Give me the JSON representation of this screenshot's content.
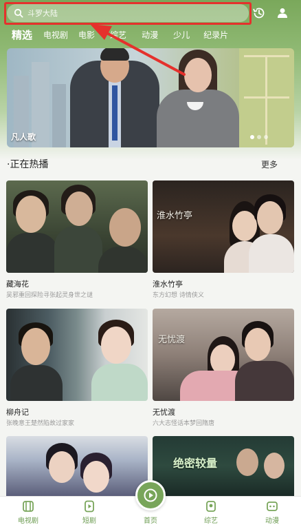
{
  "search": {
    "placeholder": "斗罗大陆"
  },
  "tabs": [
    {
      "label": "精选",
      "active": true
    },
    {
      "label": "电视剧"
    },
    {
      "label": "电影"
    },
    {
      "label": "综艺"
    },
    {
      "label": "动漫"
    },
    {
      "label": "少儿"
    },
    {
      "label": "纪录片"
    }
  ],
  "hero": {
    "title": "凡人歌",
    "slide_index": 1,
    "slide_count": 3
  },
  "section": {
    "title": "·正在热播",
    "more_label": "更多"
  },
  "cards": [
    {
      "title": "藏海花",
      "subtitle": "吴邪重回探险寻张起灵身世之谜"
    },
    {
      "title": "淮水竹亭",
      "subtitle": "东方幻想 诗情侠义",
      "poster_text": "淮水竹亭"
    },
    {
      "title": "柳舟记",
      "subtitle": "张晚意王楚然陷故过家家"
    },
    {
      "title": "无忧渡",
      "subtitle": "六大志怪话本梦回隋唐",
      "poster_text": "无忧渡"
    },
    {
      "title": "",
      "subtitle": ""
    },
    {
      "title": "",
      "subtitle": "",
      "poster_text": "绝密较量"
    }
  ],
  "bottom_nav": [
    {
      "label": "电视剧",
      "icon": "tv-series-icon"
    },
    {
      "label": "短剧",
      "icon": "short-drama-icon"
    },
    {
      "label": "首页",
      "icon": "home-play-icon",
      "active": true
    },
    {
      "label": "综艺",
      "icon": "variety-icon"
    },
    {
      "label": "动漫",
      "icon": "anime-icon"
    }
  ],
  "colors": {
    "brand_green": "#78a55a",
    "annotation_red": "#e5312c",
    "nav_label": "#6d9c52"
  }
}
